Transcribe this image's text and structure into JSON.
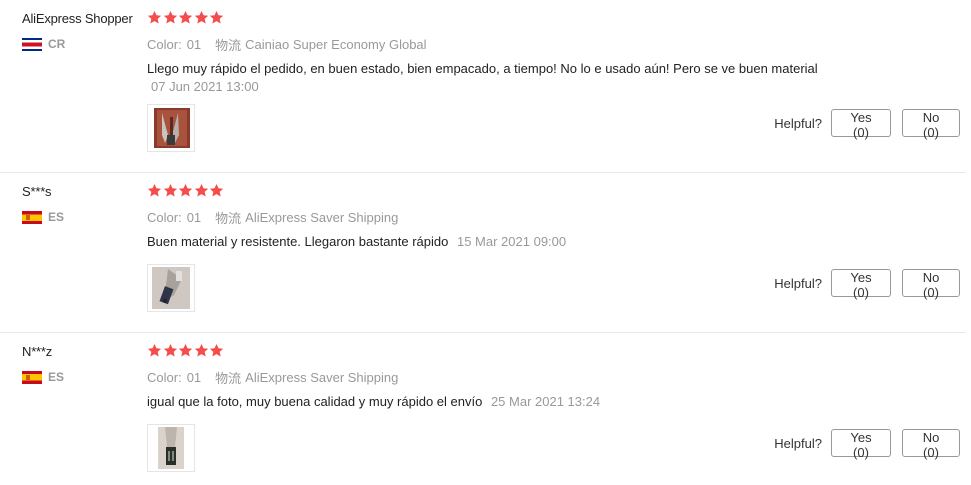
{
  "colors": {
    "star": "#f44d4d",
    "muted_text": "#999999",
    "border": "#e8e8e8"
  },
  "helpful_label": "Helpful?",
  "reviews": [
    {
      "user": "AliExpress Shopper",
      "country_code": "CR",
      "country_flag": "costa-rica-flag-icon",
      "rating": 5,
      "color_label": "Color:",
      "color_value": "01",
      "shipping_label": "物流",
      "shipping_value": "Cainiao Super Economy Global",
      "text": "Llego muy rápido el pedido, en buen estado, bien empacado, a tiempo! No lo e usado aún! Pero se ve buen material",
      "date": "07 Jun 2021 13:00",
      "yes_label": "Yes (0)",
      "no_label": "No (0)"
    },
    {
      "user": "S***s",
      "country_code": "ES",
      "country_flag": "spain-flag-icon",
      "rating": 5,
      "color_label": "Color:",
      "color_value": "01",
      "shipping_label": "物流",
      "shipping_value": "AliExpress Saver Shipping",
      "text": "Buen material y resistente. Llegaron bastante rápido",
      "date": "15 Mar 2021 09:00",
      "yes_label": "Yes (0)",
      "no_label": "No (0)"
    },
    {
      "user": "N***z",
      "country_code": "ES",
      "country_flag": "spain-flag-icon",
      "rating": 5,
      "color_label": "Color:",
      "color_value": "01",
      "shipping_label": "物流",
      "shipping_value": "AliExpress Saver Shipping",
      "text": "igual que la foto, muy buena calidad y muy rápido el envío",
      "date": "25 Mar 2021 13:24",
      "yes_label": "Yes (0)",
      "no_label": "No (0)"
    }
  ]
}
